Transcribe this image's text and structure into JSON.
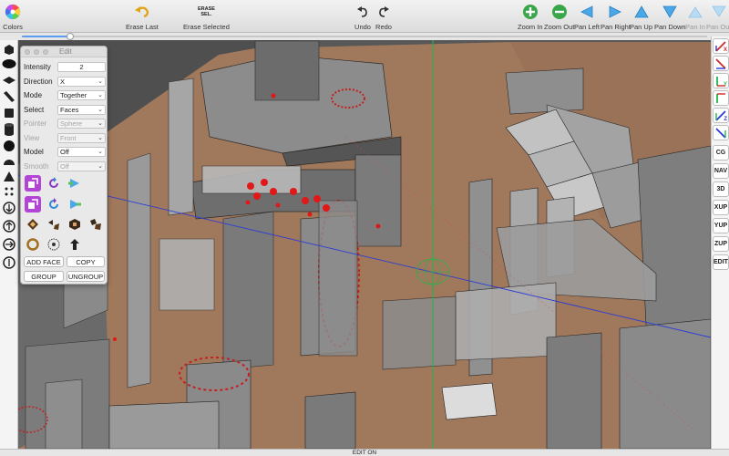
{
  "toolbar": {
    "colors_label": "Colors",
    "erase_last_label": "Erase Last",
    "erase_selected_icon_text": "ERASE\nSEL.",
    "erase_selected_label": "Erase Selected",
    "undo_label": "Undo",
    "redo_label": "Redo",
    "zoom_in_label": "Zoom In",
    "zoom_out_label": "Zoom Out",
    "pan_left_label": "Pan Left",
    "pan_right_label": "Pan Right",
    "pan_up_label": "Pan Up",
    "pan_down_label": "Pan Down",
    "pan_in_label": "Pan In",
    "pan_out_label": "Pan Out"
  },
  "zoom_slider": {
    "value": 0.07
  },
  "edit_panel": {
    "title": "Edit",
    "fields": [
      {
        "label": "Intensity",
        "value": "2",
        "enabled": true
      },
      {
        "label": "Direction",
        "value": "X",
        "enabled": true
      },
      {
        "label": "Mode",
        "value": "Together",
        "enabled": true
      },
      {
        "label": "Select",
        "value": "Faces",
        "enabled": true
      },
      {
        "label": "Pointer",
        "value": "Sphere",
        "enabled": false
      },
      {
        "label": "View",
        "value": "Front",
        "enabled": false
      },
      {
        "label": "Model",
        "value": "Off",
        "enabled": true
      },
      {
        "label": "Smooth",
        "value": "Off",
        "enabled": false
      }
    ],
    "add_face_label": "ADD FACE",
    "copy_label": "COPY",
    "group_label": "GROUP",
    "ungroup_label": "UNGROUP"
  },
  "right_bar": {
    "x_label": "X",
    "y_label": "Y",
    "z_label": "Z",
    "cg_label": "CG",
    "nav_label": "NAV",
    "view_3d_label": "3D",
    "xup_label": "XUP",
    "yup_label": "YUP",
    "zup_label": "ZUP",
    "edit_label": "EDIT"
  },
  "status": {
    "text": "EDIT ON"
  },
  "colors": {
    "floor": "#a0785c",
    "wall": "#7e7e7e",
    "selection": "#e01818",
    "accent_green": "#3aa64a",
    "accent_blue": "#4aa7e8",
    "tool_selected": "#b244d6"
  }
}
